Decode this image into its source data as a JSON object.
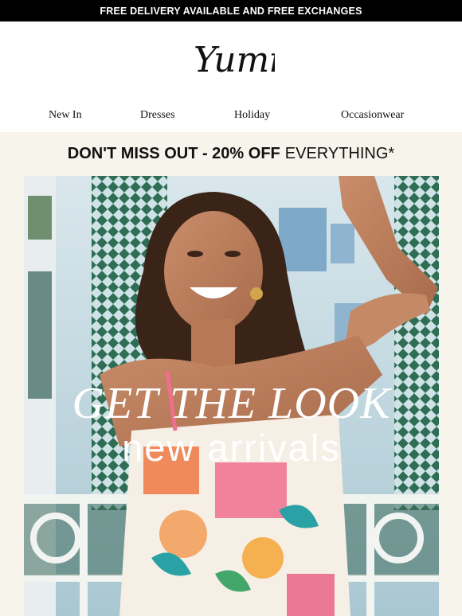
{
  "topbar": {
    "text": "FREE DELIVERY AVAILABLE AND FREE EXCHANGES"
  },
  "brand": {
    "logo": "Yumi"
  },
  "nav": {
    "items": [
      "New In",
      "Dresses",
      "Holiday",
      "Occasionwear"
    ]
  },
  "promo": {
    "bold": "DON'T MISS OUT - 20% OFF",
    "regular": "EVERYTHING*"
  },
  "hero": {
    "headline": "GET THE LOOK",
    "subheadline": "new arrivals"
  },
  "colors": {
    "topbar_bg": "#000000",
    "cream_bg": "#f7f4ec",
    "hero_sky": "#9cc0cc",
    "text": "#111111"
  }
}
